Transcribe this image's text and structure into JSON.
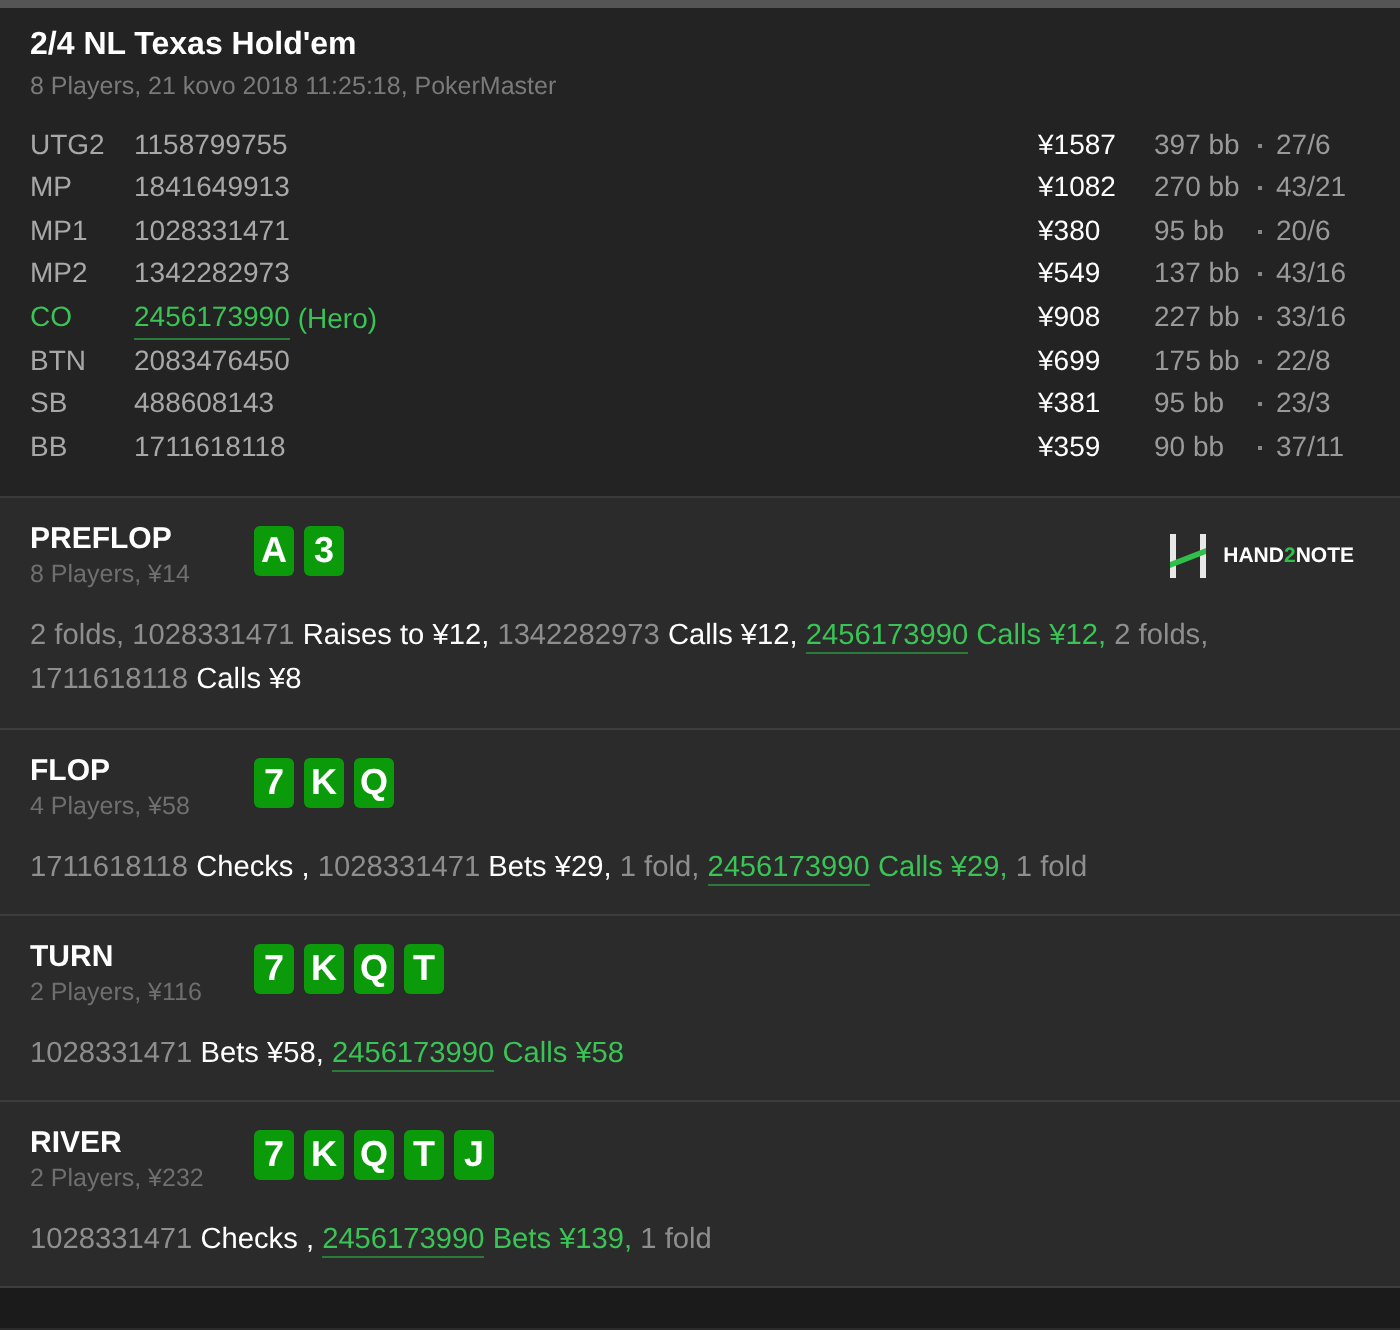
{
  "hand": {
    "title": "2/4 NL Texas Hold'em",
    "subtitle": "8 Players, 21 kovo 2018 11:25:18, PokerMaster"
  },
  "players": [
    {
      "position": "UTG2",
      "id": "1158799755",
      "hero": false,
      "stack": "¥1587",
      "bb": "397 bb",
      "stats": "27/6"
    },
    {
      "position": "MP",
      "id": "1841649913",
      "hero": false,
      "stack": "¥1082",
      "bb": "270 bb",
      "stats": "43/21"
    },
    {
      "position": "MP1",
      "id": "1028331471",
      "hero": false,
      "stack": "¥380",
      "bb": "95 bb",
      "stats": "20/6"
    },
    {
      "position": "MP2",
      "id": "1342282973",
      "hero": false,
      "stack": "¥549",
      "bb": "137 bb",
      "stats": "43/16"
    },
    {
      "position": "CO",
      "id": "2456173990",
      "hero": true,
      "tag": "(Hero)",
      "stack": "¥908",
      "bb": "227 bb",
      "stats": "33/16"
    },
    {
      "position": "BTN",
      "id": "2083476450",
      "hero": false,
      "stack": "¥699",
      "bb": "175 bb",
      "stats": "22/8"
    },
    {
      "position": "SB",
      "id": "488608143",
      "hero": false,
      "stack": "¥381",
      "bb": "95 bb",
      "stats": "23/3"
    },
    {
      "position": "BB",
      "id": "1711618118",
      "hero": false,
      "stack": "¥359",
      "bb": "90 bb",
      "stats": "37/11"
    }
  ],
  "logo": {
    "parts": [
      {
        "text": "HAND",
        "accent": false
      },
      {
        "text": "2",
        "accent": true
      },
      {
        "text": "NOTE",
        "accent": false
      }
    ]
  },
  "streets": [
    {
      "name": "PREFLOP",
      "info": "8 Players, ¥14",
      "cards": [
        "A",
        "3"
      ],
      "actions": [
        {
          "kind": "muted",
          "text": "2 folds, 1028331471"
        },
        {
          "kind": "action",
          "text": "Raises to ¥12,"
        },
        {
          "kind": "muted",
          "text": "1342282973"
        },
        {
          "kind": "action",
          "text": "Calls ¥12,"
        },
        {
          "kind": "hero",
          "text": "2456173990"
        },
        {
          "kind": "hero_action",
          "text": "Calls ¥12,"
        },
        {
          "kind": "muted",
          "text": "2 folds, 1711618118"
        },
        {
          "kind": "action",
          "text": "Calls ¥8"
        }
      ]
    },
    {
      "name": "FLOP",
      "info": "4 Players, ¥58",
      "cards": [
        "7",
        "K",
        "Q"
      ],
      "actions": [
        {
          "kind": "muted",
          "text": "1711618118"
        },
        {
          "kind": "action",
          "text": "Checks ,"
        },
        {
          "kind": "muted",
          "text": "1028331471"
        },
        {
          "kind": "action",
          "text": "Bets ¥29,"
        },
        {
          "kind": "muted",
          "text": "1 fold,"
        },
        {
          "kind": "hero",
          "text": "2456173990"
        },
        {
          "kind": "hero_action",
          "text": "Calls ¥29,"
        },
        {
          "kind": "muted",
          "text": "1 fold"
        }
      ]
    },
    {
      "name": "TURN",
      "info": "2 Players, ¥116",
      "cards": [
        "7",
        "K",
        "Q",
        "T"
      ],
      "actions": [
        {
          "kind": "muted",
          "text": "1028331471"
        },
        {
          "kind": "action",
          "text": "Bets ¥58,"
        },
        {
          "kind": "hero",
          "text": "2456173990"
        },
        {
          "kind": "hero_action",
          "text": "Calls ¥58"
        }
      ]
    },
    {
      "name": "RIVER",
      "info": "2 Players, ¥232",
      "cards": [
        "7",
        "K",
        "Q",
        "T",
        "J"
      ],
      "actions": [
        {
          "kind": "muted",
          "text": "1028331471"
        },
        {
          "kind": "action",
          "text": "Checks ,"
        },
        {
          "kind": "hero",
          "text": "2456173990"
        },
        {
          "kind": "hero_action",
          "text": "Bets ¥139,"
        },
        {
          "kind": "muted",
          "text": "1 fold"
        }
      ]
    }
  ]
}
